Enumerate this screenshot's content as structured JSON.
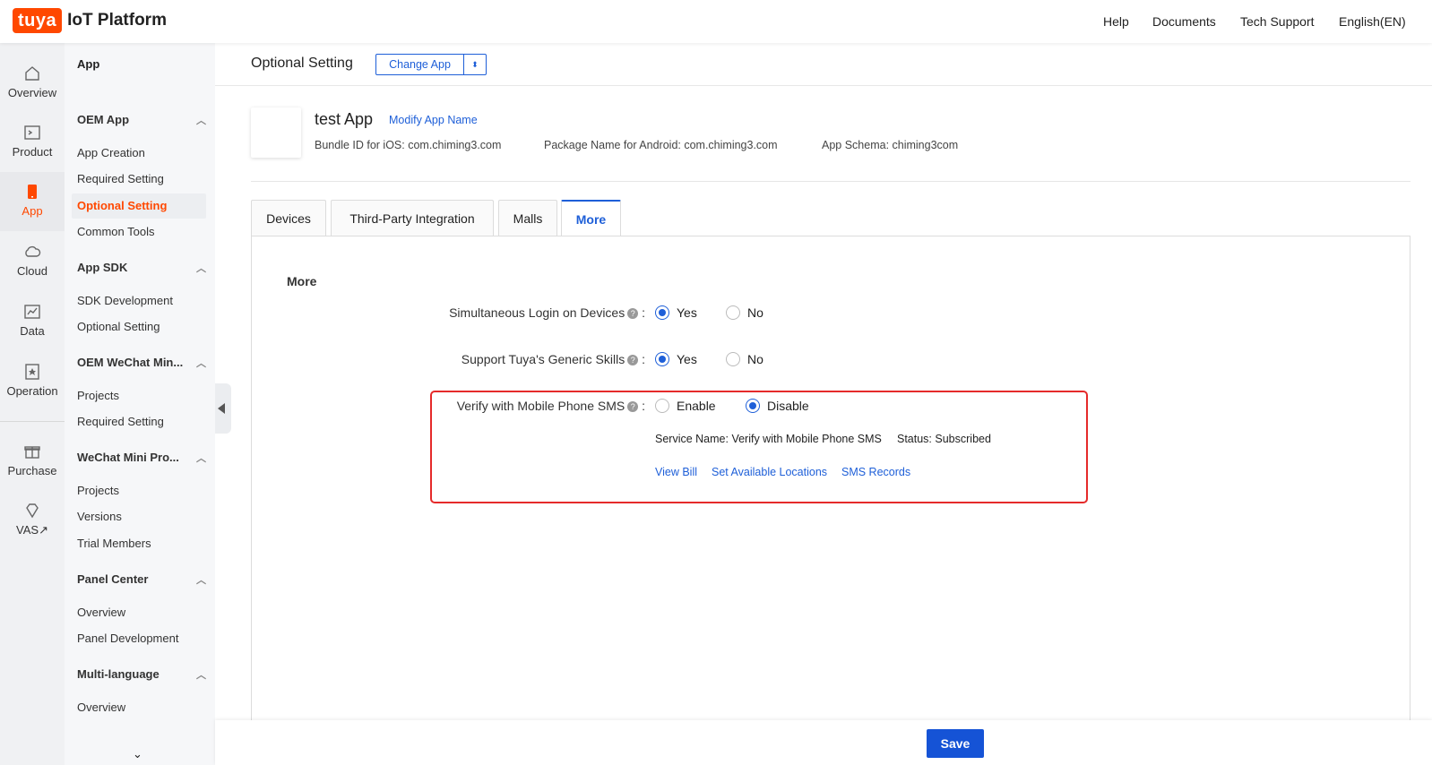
{
  "brand": {
    "logo": "tuya",
    "platform": "IoT Platform",
    "accent": "#ff4800",
    "link_color": "#1e5fd8"
  },
  "topnav": [
    "Help",
    "Documents",
    "Tech Support",
    "English(EN)"
  ],
  "rail": [
    {
      "label": "Overview",
      "icon": "home-icon"
    },
    {
      "label": "Product",
      "icon": "terminal-icon"
    },
    {
      "label": "App",
      "icon": "phone-icon",
      "active": true
    },
    {
      "label": "Cloud",
      "icon": "cloud-icon"
    },
    {
      "label": "Data",
      "icon": "chart-icon"
    },
    {
      "label": "Operation",
      "icon": "badge-icon"
    },
    {
      "label": "Purchase",
      "icon": "gift-icon"
    },
    {
      "label": "VAS",
      "icon": "diamond-icon",
      "external": "↗"
    }
  ],
  "subnav": {
    "header": "App",
    "groups": [
      {
        "title": "OEM App",
        "items": [
          "App Creation",
          "Required Setting",
          "Optional Setting",
          "Common Tools"
        ]
      },
      {
        "title": "App SDK",
        "items": [
          "SDK Development",
          "Optional Setting"
        ]
      },
      {
        "title": "OEM WeChat Min...",
        "items": [
          "Projects",
          "Required Setting"
        ]
      },
      {
        "title": "WeChat Mini Pro...",
        "items": [
          "Projects",
          "Versions",
          "Trial Members"
        ]
      },
      {
        "title": "Panel Center",
        "items": [
          "Overview",
          "Panel Development"
        ]
      },
      {
        "title": "Multi-language",
        "items": [
          "Overview"
        ]
      }
    ]
  },
  "header": {
    "title": "Optional Setting",
    "change_app": "Change App",
    "change_app_arrow": "⬍"
  },
  "app": {
    "name": "test App",
    "modify": "Modify App Name",
    "bundle_ios": "Bundle ID for iOS: com.chiming3.com",
    "package_android": "Package Name for Android: com.chiming3.com",
    "schema": "App Schema: chiming3com"
  },
  "tabs": [
    "Devices",
    "Third-Party Integration",
    "Malls",
    "More"
  ],
  "section": "More",
  "form": {
    "login_label": "Simultaneous Login on Devices",
    "skills_label": "Support Tuya's Generic Skills",
    "sms_label": "Verify with Mobile Phone SMS",
    "colon": ":",
    "help": "?",
    "yes": "Yes",
    "no": "No",
    "enable": "Enable",
    "disable": "Disable",
    "service_name": "Service Name: Verify with Mobile Phone SMS",
    "status": "Status: Subscribed",
    "links": [
      "View Bill",
      "Set Available Locations",
      "SMS Records"
    ]
  },
  "save": "Save",
  "scroll_more": "⌄"
}
